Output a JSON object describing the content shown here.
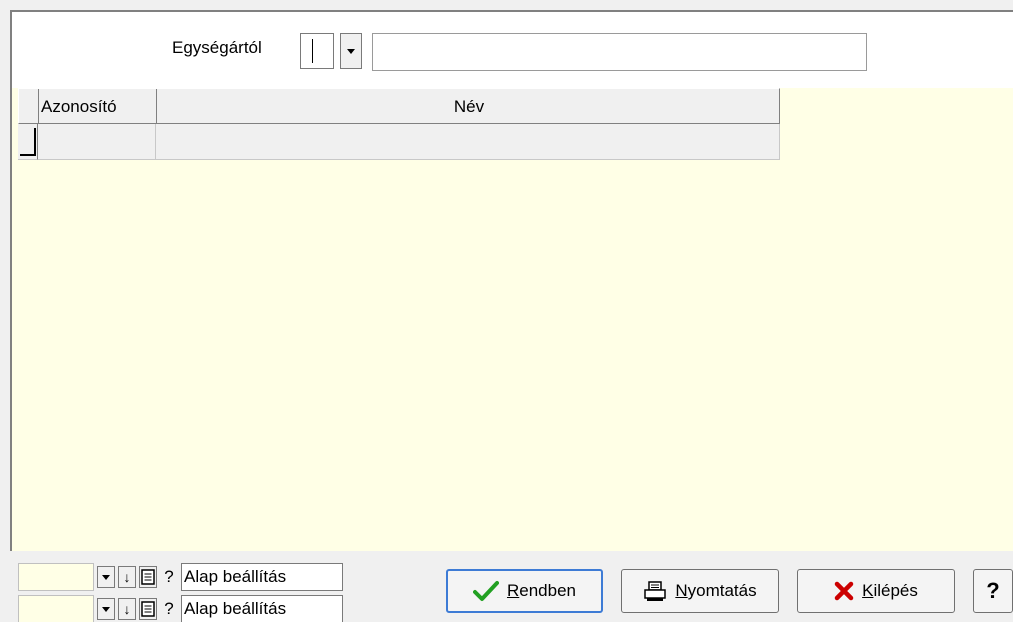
{
  "filter": {
    "unit_label": "Egységártól",
    "unit_code_value": "",
    "unit_name_value": ""
  },
  "grid": {
    "columns": [
      {
        "label": "Azonosító"
      },
      {
        "label": "Név"
      }
    ],
    "rows": [
      {
        "id": "",
        "name": ""
      }
    ]
  },
  "presets": [
    {
      "value": "",
      "label": "Alap beállítás"
    },
    {
      "value": "",
      "label": "Alap beállítás"
    }
  ],
  "buttons": {
    "ok": {
      "accel": "R",
      "rest": "endben"
    },
    "print": {
      "accel": "N",
      "rest": "yomtatás"
    },
    "exit": {
      "accel": "K",
      "rest": "ilépés"
    },
    "help": "?"
  },
  "icons": {
    "ok": "check-icon",
    "print": "printer-icon",
    "exit": "x-icon",
    "dropdown": "chevron-down-icon",
    "down": "arrow-down-icon",
    "doc": "document-icon",
    "help": "question-icon"
  },
  "colors": {
    "yellow_bg": "#ffffe6",
    "ok_border": "#3d7bd5",
    "check": "#22a022",
    "exit_x": "#cc0000"
  }
}
